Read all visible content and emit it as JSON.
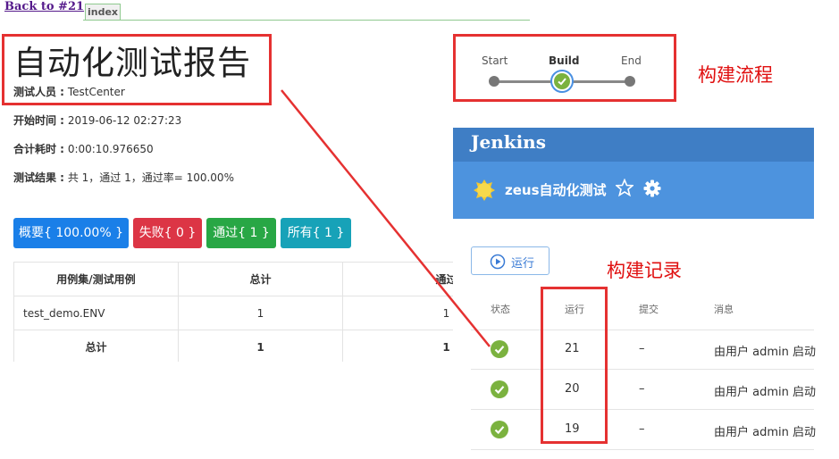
{
  "nav": {
    "back_label": "Back to #21",
    "index_tab": "index"
  },
  "report": {
    "title": "自动化测试报告",
    "tester_label": "测试人员 :",
    "tester_value": "TestCenter",
    "start_label": "开始时间 :",
    "start_value": "2019-06-12 02:27:23",
    "duration_label": "合计耗时 :",
    "duration_value": "0:00:10.976650",
    "result_label": "测试结果 :",
    "result_value": "共 1，通过 1，通过率= 100.00%"
  },
  "filters": [
    {
      "label": "概要{ 100.00% }",
      "color": "#1a7fe8"
    },
    {
      "label": "失败{ 0 }",
      "color": "#dc3545"
    },
    {
      "label": "通过{ 1 }",
      "color": "#28a745"
    },
    {
      "label": "所有{ 1 }",
      "color": "#17a2b8"
    }
  ],
  "table": {
    "headers": [
      "用例集/测试用例",
      "总计",
      "通过"
    ],
    "rows": [
      [
        "test_demo.ENV",
        "1",
        "1"
      ]
    ],
    "total_row": [
      "总计",
      "1",
      "1"
    ]
  },
  "pipeline": {
    "stages": [
      "Start",
      "Build",
      "End"
    ],
    "annotation": "构建流程"
  },
  "jenkins": {
    "logo": "Jenkins",
    "job_name": "zeus自动化测试",
    "run_label": "运行",
    "history_annotation": "构建记录",
    "columns": [
      "状态",
      "运行",
      "提交",
      "消息"
    ],
    "builds": [
      {
        "run": "21",
        "commit": "–",
        "message": "由用户 admin 启动"
      },
      {
        "run": "20",
        "commit": "–",
        "message": "由用户 admin 启动"
      },
      {
        "run": "19",
        "commit": "–",
        "message": "由用户 admin 启动"
      }
    ]
  },
  "colors": {
    "annotation_red": "#e53131",
    "jenkins_blue": "#3f7ec5",
    "success_green": "#7bb23f"
  }
}
